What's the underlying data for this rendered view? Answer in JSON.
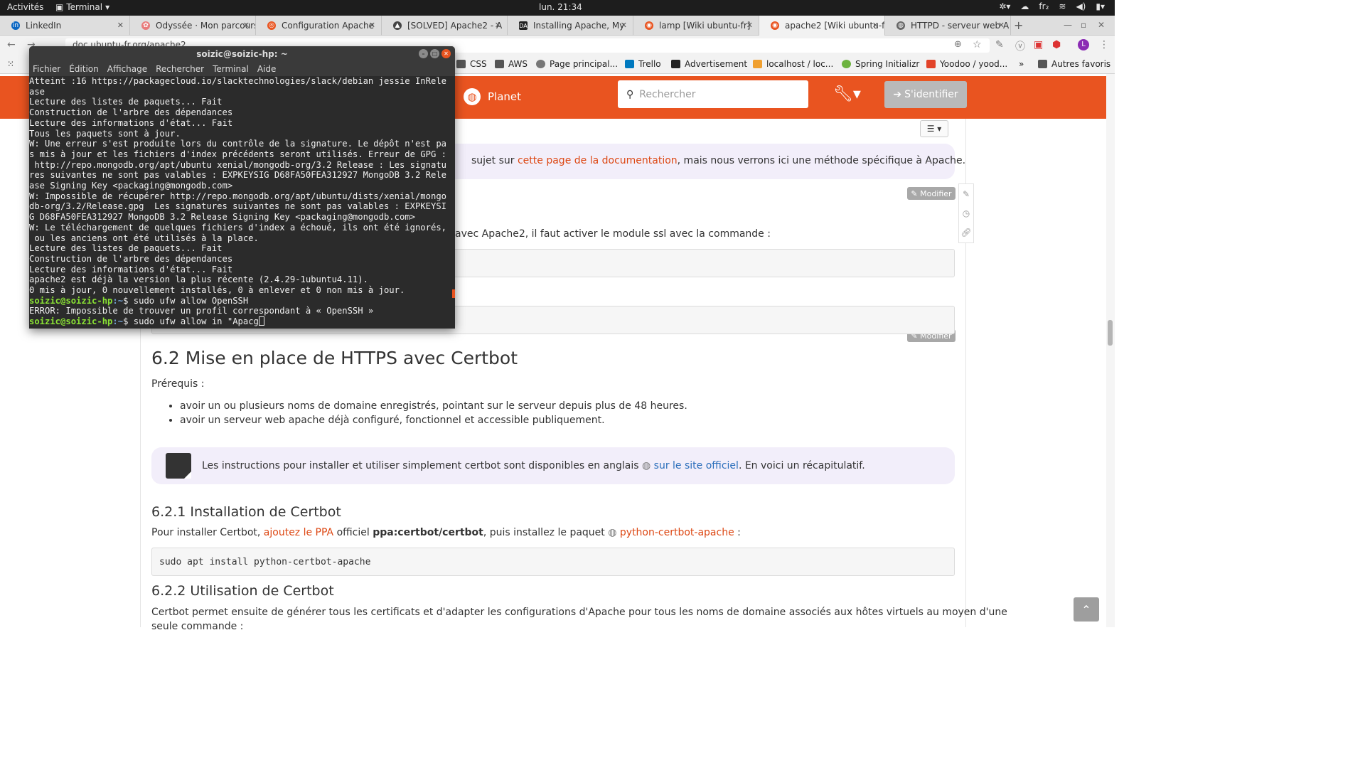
{
  "topbar": {
    "activities": "Activités",
    "app": "Terminal",
    "clock": "lun. 21:34",
    "lang": "fr₂"
  },
  "tabs": [
    {
      "label": "LinkedIn",
      "color": "#0a66c2",
      "glyph": "in"
    },
    {
      "label": "Odyssée · Mon parcours",
      "color": "#e87b7b",
      "glyph": "✿"
    },
    {
      "label": "Configuration Apache",
      "color": "#e95420",
      "glyph": "◎"
    },
    {
      "label": "[SOLVED] Apache2 - A",
      "color": "#444444",
      "glyph": "▲"
    },
    {
      "label": "Installing Apache, My",
      "color": "#222222",
      "glyph": "DA"
    },
    {
      "label": "lamp [Wiki ubuntu-fr]",
      "color": "#e95420",
      "glyph": "◉"
    },
    {
      "label": "apache2 [Wiki ubuntu-fr]",
      "color": "#e95420",
      "glyph": "◉"
    },
    {
      "label": "HTTPD - serveur web A",
      "color": "#666666",
      "glyph": "◍"
    }
  ],
  "url": "doc.ubuntu-fr.org/apache2",
  "bookmarks": [
    {
      "label": "CSS",
      "color": "#555555"
    },
    {
      "label": "AWS",
      "color": "#555555"
    },
    {
      "label": "Page principal...",
      "color": "#777777"
    },
    {
      "label": "Trello",
      "color": "#0079bf"
    },
    {
      "label": "Advertisement",
      "color": "#222222"
    },
    {
      "label": "localhost / loc...",
      "color": "#f0a030"
    },
    {
      "label": "Spring Initializr",
      "color": "#6db33f"
    },
    {
      "label": "Yoodoo / yood...",
      "color": "#e24329"
    }
  ],
  "bookmarks_more": "»",
  "bookmarks_other": "Autres favoris",
  "site": {
    "planet": "Planet",
    "search_placeholder": "Rechercher",
    "login": "S'identifier",
    "toc": "☰ ▾"
  },
  "note1": {
    "before": "sujet sur ",
    "link": "cette page de la documentation",
    "after": ", mais nous verrons ici une méthode spécifique à Apache."
  },
  "modifier": "✎ Modifier",
  "ssl_text": "avec Apache2, il faut activer le module ssl avec la commande :",
  "h2": "6.2 Mise en place de HTTPS avec Certbot",
  "prereq": "Prérequis :",
  "reqs": [
    "avoir un ou plusieurs noms de domaine enregistrés, pointant sur le serveur depuis plus de 48 heures.",
    "avoir un serveur web apache déjà configuré, fonctionnel et accessible publiquement."
  ],
  "note2": {
    "before": "Les instructions pour installer et utiliser simplement certbot sont disponibles en anglais ",
    "link": "sur le site officiel",
    "after": ". En voici un récapitulatif."
  },
  "h3a": "6.2.1 Installation de Certbot",
  "install": {
    "p1": "Pour installer Certbot, ",
    "link1": "ajoutez le PPA",
    "p2": " officiel ",
    "ppa": "ppa:certbot/certbot",
    "p3": ", puis installez le paquet ",
    "link2": "python-certbot-apache",
    "p4": " :"
  },
  "code_install": "sudo apt install python-certbot-apache",
  "h3b": "6.2.2 Utilisation de Certbot",
  "usage": "Certbot permet ensuite de générer tous les certificats et d'adapter les configurations d'Apache pour tous les noms de domaine associés aux hôtes virtuels au moyen d'une",
  "usage2": "seule commande :",
  "terminal": {
    "title": "soizic@soizic-hp: ~",
    "menu": [
      "Fichier",
      "Édition",
      "Affichage",
      "Rechercher",
      "Terminal",
      "Aide"
    ],
    "lines": [
      "Atteint :16 https://packagecloud.io/slacktechnologies/slack/debian jessie InRele",
      "ase",
      "Lecture des listes de paquets... Fait",
      "Construction de l'arbre des dépendances",
      "Lecture des informations d'état... Fait",
      "Tous les paquets sont à jour.",
      "W: Une erreur s'est produite lors du contrôle de la signature. Le dépôt n'est pa",
      "s mis à jour et les fichiers d'index précédents seront utilisés. Erreur de GPG :",
      " http://repo.mongodb.org/apt/ubuntu xenial/mongodb-org/3.2 Release : Les signatu",
      "res suivantes ne sont pas valables : EXPKEYSIG D68FA50FEA312927 MongoDB 3.2 Rele",
      "ase Signing Key <packaging@mongodb.com>",
      "W: Impossible de récupérer http://repo.mongodb.org/apt/ubuntu/dists/xenial/mongo",
      "db-org/3.2/Release.gpg  Les signatures suivantes ne sont pas valables : EXPKEYSI",
      "G D68FA50FEA312927 MongoDB 3.2 Release Signing Key <packaging@mongodb.com>",
      "W: Le téléchargement de quelques fichiers d'index a échoué, ils ont été ignorés,",
      " ou les anciens ont été utilisés à la place.",
      "Lecture des listes de paquets... Fait",
      "Construction de l'arbre des dépendances",
      "Lecture des informations d'état... Fait",
      "apache2 est déjà la version la plus récente (2.4.29-1ubuntu4.11).",
      "0 mis à jour, 0 nouvellement installés, 0 à enlever et 0 non mis à jour."
    ],
    "prompt_user": "soizic@soizic-hp",
    "prompt_path": ":~",
    "prompt_sign": "$ ",
    "cmd1": "sudo ufw allow OpenSSH",
    "error": "ERROR: Impossible de trouver un profil correspondant à « OpenSSH »",
    "cmd2": "sudo ufw allow in \"Apacg"
  }
}
